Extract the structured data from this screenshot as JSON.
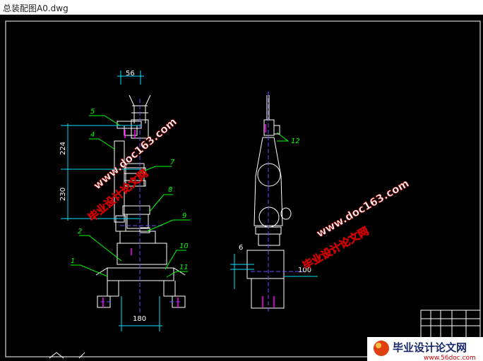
{
  "window": {
    "title": "总装配图A0.dwg"
  },
  "drawing": {
    "dimensions": {
      "top_width": "56",
      "upper_height": "224",
      "lower_height": "230",
      "base_width": "180",
      "side_offset": "6",
      "side_width": "100"
    },
    "callouts": [
      "1",
      "2",
      "4",
      "5",
      "7",
      "8",
      "9",
      "10",
      "11",
      "12"
    ],
    "watermark": {
      "site": "www.doc163.com",
      "brand": "毕业设计论文网"
    },
    "logo": {
      "text": "毕业设计论文网",
      "url": "www.56doc.com"
    }
  }
}
